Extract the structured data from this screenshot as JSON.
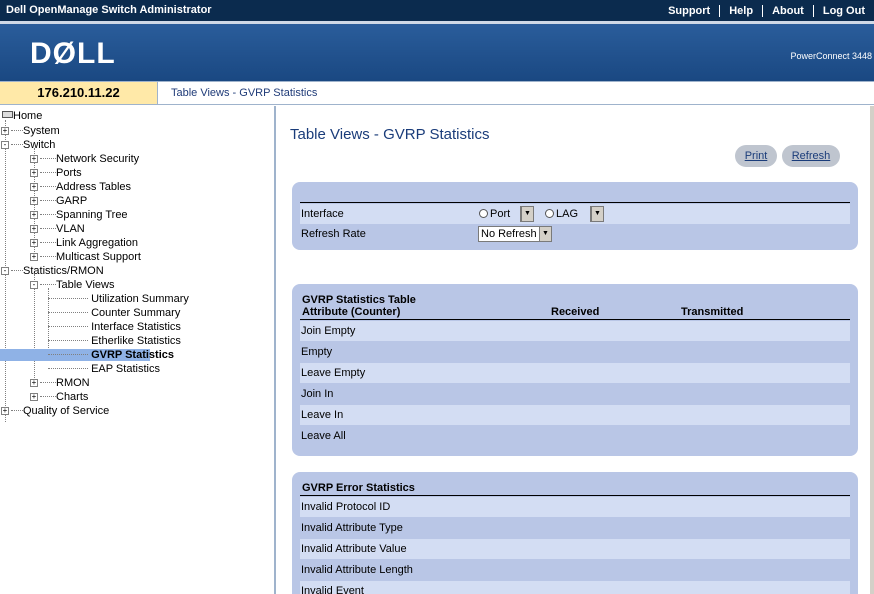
{
  "topbar": {
    "title": "Dell OpenManage Switch Administrator",
    "links": [
      "Support",
      "Help",
      "About",
      "Log Out"
    ]
  },
  "logo": {
    "text": "DØLL",
    "model": "PowerConnect 3448"
  },
  "ipbar": {
    "ip": "176.210.11.22",
    "breadcrumb": "Table Views - GVRP Statistics"
  },
  "nav": {
    "home": "Home",
    "system": "System",
    "switch": "Switch",
    "switch_children": [
      "Network Security",
      "Ports",
      "Address Tables",
      "GARP",
      "Spanning Tree",
      "VLAN",
      "Link Aggregation",
      "Multicast Support"
    ],
    "stats": "Statistics/RMON",
    "table_views": "Table Views",
    "table_views_children": [
      "Utilization Summary",
      "Counter Summary",
      "Interface Statistics",
      "Etherlike Statistics",
      "GVRP Statistics",
      "EAP Statistics"
    ],
    "rmon": "RMON",
    "charts": "Charts",
    "qos": "Quality of Service"
  },
  "main": {
    "title": "Table Views - GVRP Statistics",
    "print_label": "Print",
    "refresh_label": "Refresh",
    "interface_label": "Interface",
    "port_label": "Port",
    "lag_label": "LAG",
    "refresh_rate_label": "Refresh Rate",
    "refresh_rate_value": "No Refresh",
    "gvrp_table": {
      "title": "GVRP Statistics Table",
      "col_attr": "Attribute (Counter)",
      "col_received": "Received",
      "col_transmitted": "Transmitted",
      "rows": [
        "Join Empty",
        "Empty",
        "Leave Empty",
        "Join In",
        "Leave In",
        "Leave All"
      ]
    },
    "error_table": {
      "title": "GVRP Error Statistics",
      "rows": [
        "Invalid Protocol ID",
        "Invalid Attribute Type",
        "Invalid Attribute Value",
        "Invalid Attribute Length",
        "Invalid Event"
      ]
    }
  },
  "colors": {
    "topbar": "#0b2b4e",
    "logoband": "#1a4882",
    "panel": "#b9c6e6",
    "row_light": "#d3ddf3",
    "selected": "#8fb2e6"
  }
}
